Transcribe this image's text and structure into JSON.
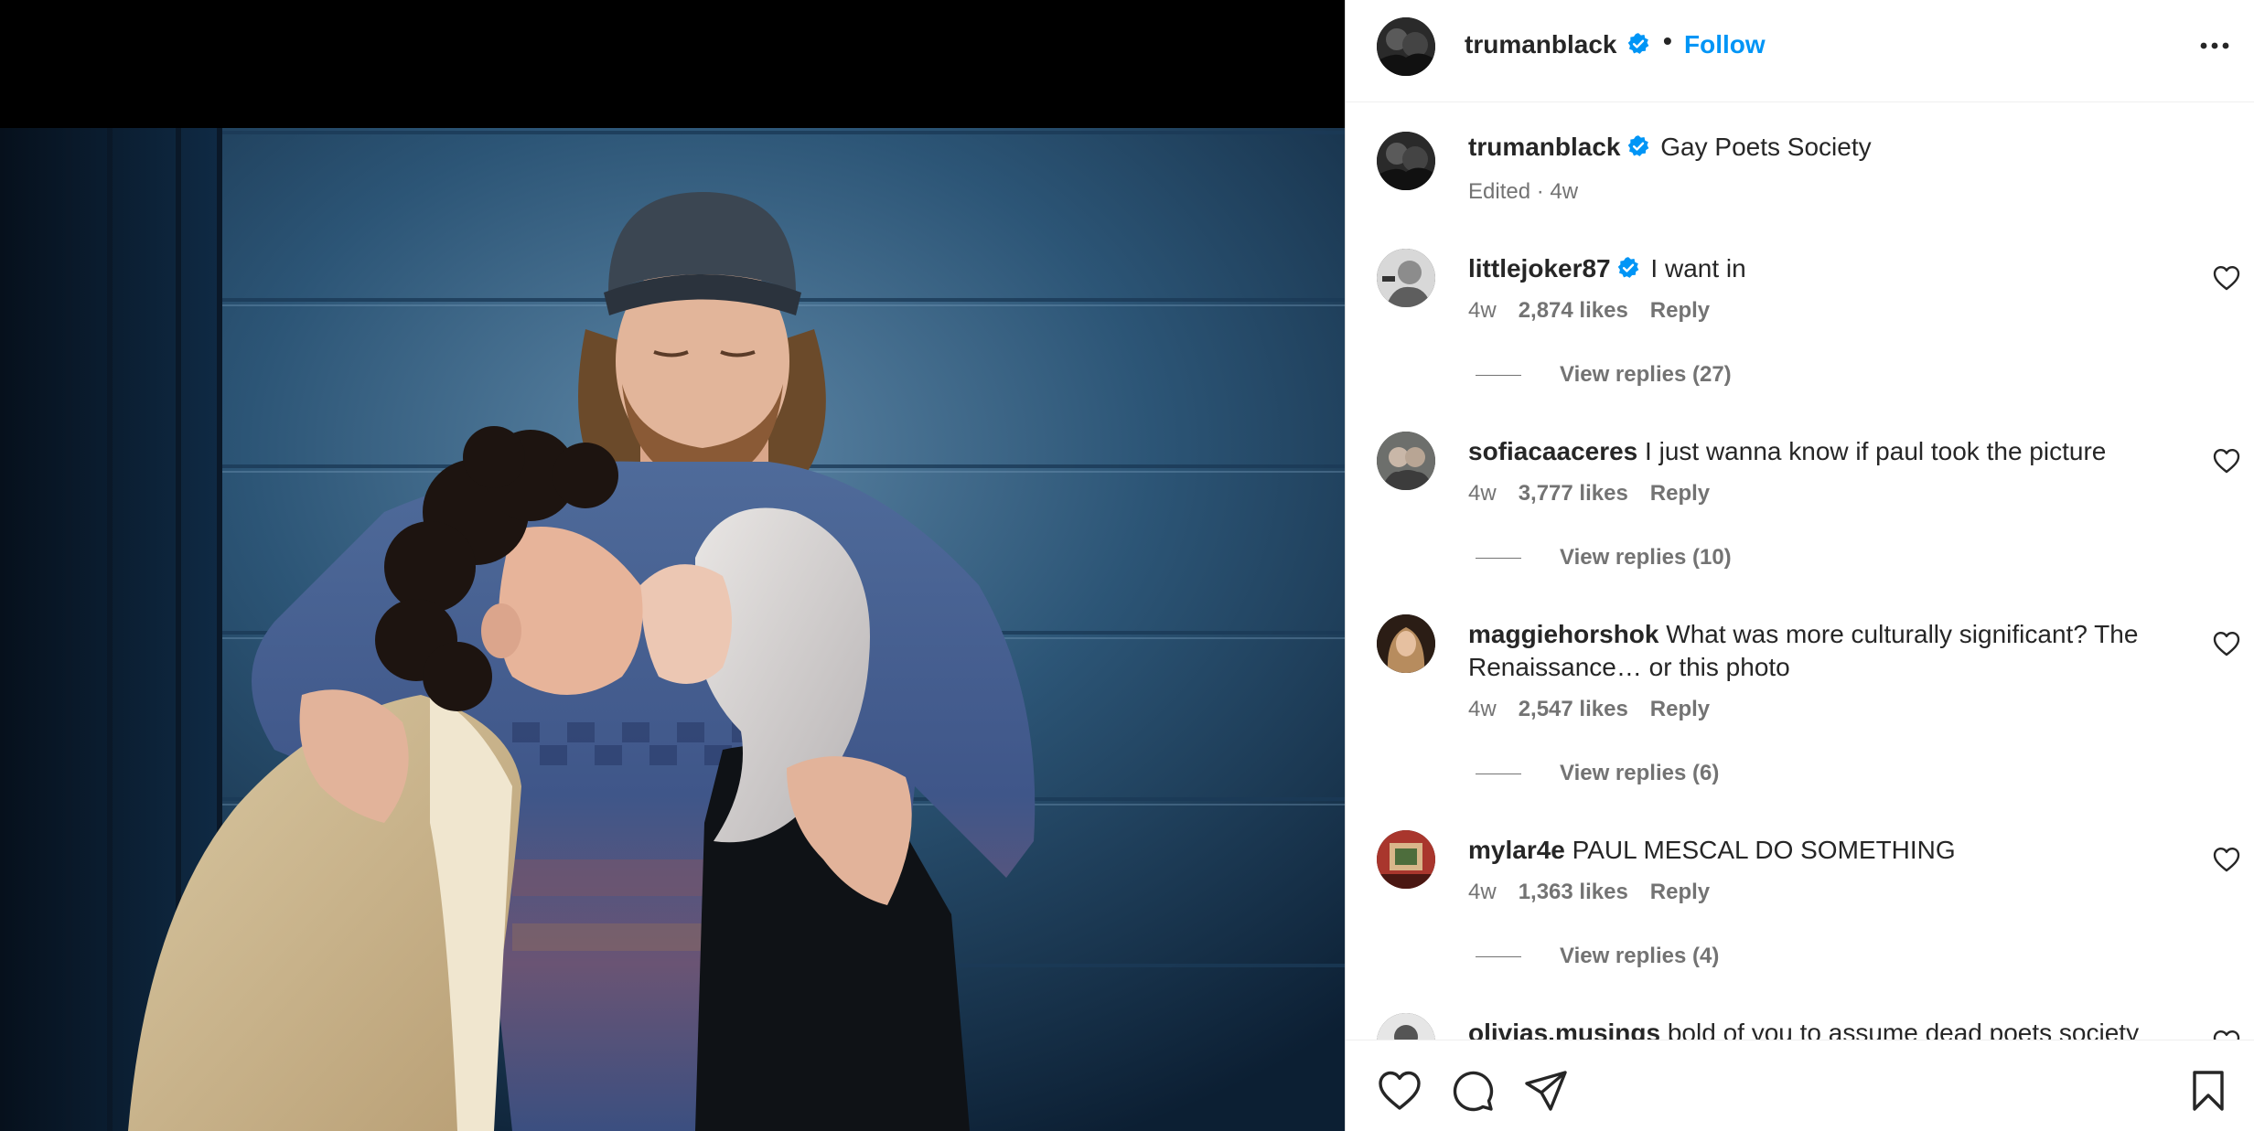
{
  "post": {
    "author": "trumanblack",
    "separator": "•",
    "follow_label": "Follow",
    "caption": {
      "user": "trumanblack",
      "text": "Gay Poets Society",
      "meta": "Edited · 4w"
    }
  },
  "comments": [
    {
      "user": "littlejoker87",
      "verified": true,
      "text": "I want in",
      "time": "4w",
      "likes": "2,874 likes",
      "reply": "Reply",
      "view_replies": "View replies (27)"
    },
    {
      "user": "sofiacaaceres",
      "verified": false,
      "text": "I just wanna know if paul took the picture",
      "time": "4w",
      "likes": "3,777 likes",
      "reply": "Reply",
      "view_replies": "View replies (10)"
    },
    {
      "user": "maggiehorshok",
      "verified": false,
      "text": "What was more culturally significant? The Renaissance… or this photo",
      "time": "4w",
      "likes": "2,547 likes",
      "reply": "Reply",
      "view_replies": "View replies (6)"
    },
    {
      "user": "mylar4e",
      "verified": false,
      "text": "PAUL MESCAL DO SOMETHING",
      "time": "4w",
      "likes": "1,363 likes",
      "reply": "Reply",
      "view_replies": "View replies (4)"
    },
    {
      "user": "olivias.musings",
      "verified": false,
      "text": "bold of you to assume dead poets society"
    }
  ],
  "icons": {
    "verified": "verified-badge-icon",
    "more": "more-options-icon",
    "like": "heart-icon",
    "comment": "comment-icon",
    "share": "paper-plane-icon",
    "save": "bookmark-icon"
  },
  "colors": {
    "link": "#0095f6",
    "verified": "#0095f6",
    "muted": "#737373"
  }
}
